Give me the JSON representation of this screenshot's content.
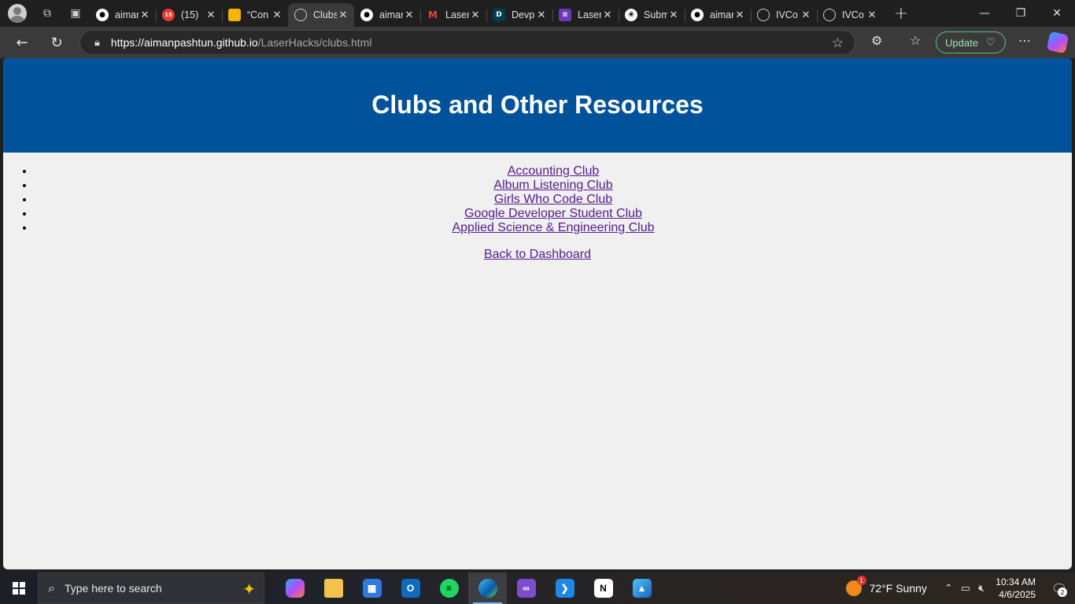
{
  "browser": {
    "tabs": [
      {
        "title": "aiman",
        "favicon": "github-icon",
        "color": "#ffffff"
      },
      {
        "title": "(15)",
        "favicon": "notification-icon",
        "color": "#e53935"
      },
      {
        "title": "“Con",
        "favicon": "slides-icon",
        "color": "#f4b400"
      },
      {
        "title": "Clubs",
        "favicon": "globe-icon",
        "color": "#cccccc",
        "active": true
      },
      {
        "title": "aiman",
        "favicon": "github-icon",
        "color": "#ffffff"
      },
      {
        "title": "Laser",
        "favicon": "gmail-icon",
        "color": "#ea4335"
      },
      {
        "title": "Devp",
        "favicon": "devpost-icon",
        "color": "#003e54"
      },
      {
        "title": "Laser",
        "favicon": "forms-icon",
        "color": "#673ab7"
      },
      {
        "title": "Subm",
        "favicon": "openai-icon",
        "color": "#ffffff"
      },
      {
        "title": "aiman",
        "favicon": "github-icon",
        "color": "#ffffff"
      },
      {
        "title": "IVCo",
        "favicon": "globe-icon",
        "color": "#cccccc"
      },
      {
        "title": "IVCo",
        "favicon": "globe-icon",
        "color": "#cccccc"
      }
    ],
    "tab_badge": "15",
    "url_host": "https://aimanpashtun.github.io",
    "url_path": "/LaserHacks/clubs.html",
    "update_label": "Update"
  },
  "page": {
    "title": "Clubs and Other Resources",
    "clubs": [
      "Accounting Club",
      "Album Listening Club",
      "Girls Who Code Club",
      "Google Developer Student Club",
      "Applied Science & Engineering Club"
    ],
    "back_link": "Back to Dashboard",
    "header_color": "#00529b",
    "link_color": "#551a8b"
  },
  "taskbar": {
    "search_placeholder": "Type here to search",
    "apps": [
      "copilot-icon",
      "file-explorer-icon",
      "microsoft-store-icon",
      "outlook-icon",
      "spotify-icon",
      "edge-icon",
      "visual-studio-icon",
      "vscode-icon",
      "notion-icon",
      "photos-icon"
    ],
    "weather": "72°F  Sunny",
    "weather_badge": "1",
    "time": "10:34 AM",
    "date": "4/6/2025",
    "notification_count": "2"
  }
}
